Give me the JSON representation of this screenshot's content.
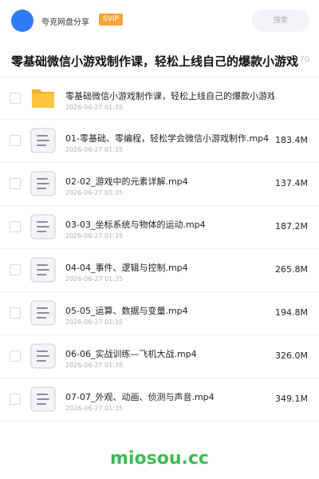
{
  "header": {
    "user_name": "夸克网盘分享",
    "badge": "SVIP",
    "search_placeholder": "搜索"
  },
  "share": {
    "title": "零基础微信小游戏制作课，轻松上线自己的爆款小游戏",
    "total_size": "7G"
  },
  "items": [
    {
      "type": "folder",
      "name": "零基础微信小游戏制作课，轻松上线自己的爆款小游戏",
      "date": "2026-06-27 01:35",
      "size": ""
    },
    {
      "type": "file",
      "name": "01-零基础、零编程，轻松学会微信小游戏制作.mp4",
      "date": "2026-06-27 01:35",
      "size": "183.4M"
    },
    {
      "type": "file",
      "name": "02-02_游戏中的元素详解.mp4",
      "date": "2026-06-27 01:35",
      "size": "137.4M"
    },
    {
      "type": "file",
      "name": "03-03_坐标系统与物体的运动.mp4",
      "date": "2026-06-27 01:35",
      "size": "187.2M"
    },
    {
      "type": "file",
      "name": "04-04_事件、逻辑与控制.mp4",
      "date": "2026-06-27 01:35",
      "size": "265.8M"
    },
    {
      "type": "file",
      "name": "05-05_运算、数据与变量.mp4",
      "date": "2026-06-27 01:35",
      "size": "194.8M"
    },
    {
      "type": "file",
      "name": "06-06_实战训练—飞机大战.mp4",
      "date": "2026-06-27 01:35",
      "size": "326.0M"
    },
    {
      "type": "file",
      "name": "07-07_外观、动画、侦测与声音.mp4",
      "date": "2026-06-27 01:35",
      "size": "349.1M"
    }
  ],
  "footer": {
    "watermark": "miosou.cc"
  },
  "colors": {
    "avatar": "#2f7af5",
    "badge": "#f7a436",
    "folder": "#ffc53d",
    "watermark": "#3dbb55"
  }
}
